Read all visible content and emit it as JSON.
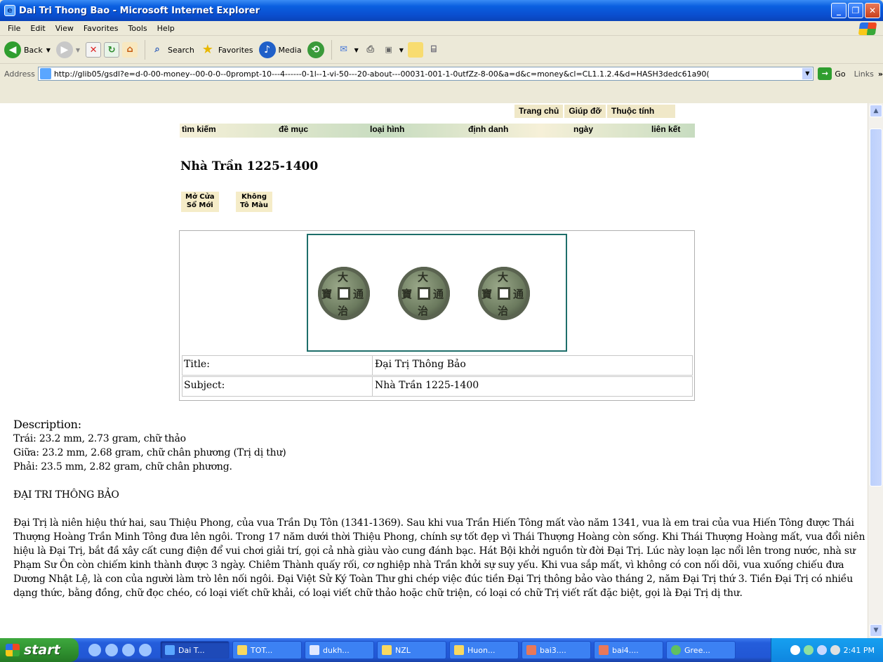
{
  "window": {
    "title": "Dai Tri Thong Bao - Microsoft Internet Explorer"
  },
  "menu": [
    "File",
    "Edit",
    "View",
    "Favorites",
    "Tools",
    "Help"
  ],
  "toolbar": {
    "back": "Back",
    "search": "Search",
    "favorites": "Favorites",
    "media": "Media"
  },
  "address": {
    "label": "Address",
    "url": "http://glib05/gsdl?e=d-0-00-money--00-0-0--0prompt-10---4------0-1l--1-vi-50---20-about---00031-001-1-0utfZz-8-00&a=d&c=money&cl=CL1.1.2.4&d=HASH3dedc61a90(",
    "go": "Go",
    "links": "Links"
  },
  "page": {
    "topnav": [
      "Trang chủ",
      "Giúp đỡ",
      "Thuộc tính"
    ],
    "mainnav": [
      "tìm kiếm",
      "đề mục",
      "loại hình",
      "định danh",
      "ngày",
      "liên kết"
    ],
    "title": "Nhà Trần 1225-1400",
    "buttons": {
      "new_window": [
        "Mở Cửa",
        "Sổ Mới"
      ],
      "no_color": [
        "Không",
        "Tô Màu"
      ]
    },
    "record": [
      {
        "label": "Title:",
        "value": "Đại Trị Thông Bảo"
      },
      {
        "label": "Subject:",
        "value": "Nhà Trần 1225-1400"
      }
    ],
    "description": {
      "heading": "Description:",
      "lines": [
        "Trái: 23.2 mm, 2.73 gram, chữ thảo",
        "Giữa: 23.2 mm, 2.68 gram, chữ chân phương (Trị dị thư)",
        "Phải: 23.5 mm, 2.82 gram, chữ chân phương."
      ],
      "caps": "ĐẠI TRI THÔNG BẢO",
      "paragraph": "Đại Trị là niên hiệu thứ hai, sau Thiệu Phong, của vua Trần Dụ Tôn (1341-1369). Sau khi vua Trần Hiến Tông mất vào năm 1341, vua là em trai của vua Hiến Tông được Thái Thượng Hoàng Trần Minh Tông đưa lên ngôi. Trong 17 năm dưới thời Thiệu Phong, chính sự tốt đẹp vì Thái Thượng Hoàng còn sống. Khi Thái Thượng Hoàng mất, vua đổi niên hiệu là Đại Trị, bắt đầ xây cất cung điện để vui chơi giải trí, gọi cả nhà giàu vào cung đánh bạc. Hát Bội khởi nguồn từ đời Đại Trị. Lúc này loạn lạc nổi lên trong nước, nhà sư Phạm Sư Ôn còn chiếm kinh thành được 3 ngày. Chiêm Thành quấy rối, cơ nghiệp nhà Trần khởi sự suy yếu. Khi vua sắp mất, vì không có con nối dõi, vua xuống chiếu đưa Dương Nhật Lệ, là con của người làm trò lên nối ngôi. Đại Việt Sử Ký Toàn Thư ghi chép việc đúc tiền Đại Trị thông bảo vào tháng 2, năm Đại Trị thứ 3. Tiền Đại Trị có nhiều dạng thức, bằng đồng, chữ đọc chéo, có loại viết chữ khải, có loại viết chữ thảo hoặc chữ triện, có loại có chữ Trị viết rất đặc biệt, gọi là Đại Trị dị thư."
    }
  },
  "taskbar": {
    "start": "start",
    "tasks": [
      "Dai T...",
      "TOT...",
      "dukh...",
      "NZL",
      "Huon...",
      "bai3....",
      "bai4....",
      "Gree..."
    ],
    "clock": "2:41 PM"
  }
}
